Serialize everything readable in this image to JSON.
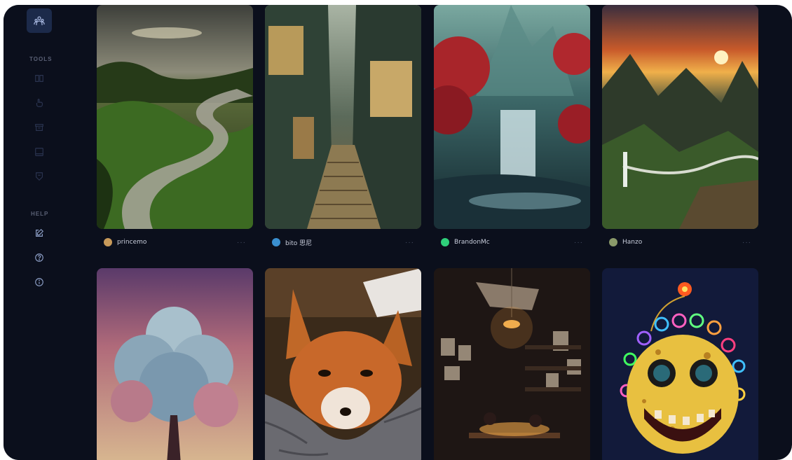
{
  "sidebar": {
    "sections": [
      {
        "label": "TOOLS"
      },
      {
        "label": "HELP"
      }
    ],
    "icons": {
      "logo": "community-icon",
      "tools": [
        "book-icon",
        "hand-pointer-icon",
        "archive-icon",
        "window-icon",
        "badge-icon"
      ],
      "help": [
        "edit-icon",
        "help-circle-icon",
        "info-icon"
      ]
    }
  },
  "gallery": {
    "rows": [
      [
        {
          "author": "princemo",
          "avatar_color": "#c89a5a",
          "more": "···"
        },
        {
          "author": "bito 思尼",
          "avatar_color": "#3a8fd0",
          "more": "···"
        },
        {
          "author": "BrandonMc",
          "avatar_color": "#2fd07a",
          "more": "···"
        },
        {
          "author": "Hanzo",
          "avatar_color": "#8a9a6a",
          "more": "···"
        }
      ],
      [
        {
          "author": "",
          "avatar_color": "",
          "more": ""
        },
        {
          "author": "",
          "avatar_color": "",
          "more": ""
        },
        {
          "author": "",
          "avatar_color": "",
          "more": ""
        },
        {
          "author": "",
          "avatar_color": "",
          "more": ""
        }
      ]
    ]
  },
  "colors": {
    "app_bg": "#0b0f1c",
    "sidebar_active": "#1c2a4a",
    "section_label": "#5a6075",
    "author_text": "#c9cedc"
  }
}
